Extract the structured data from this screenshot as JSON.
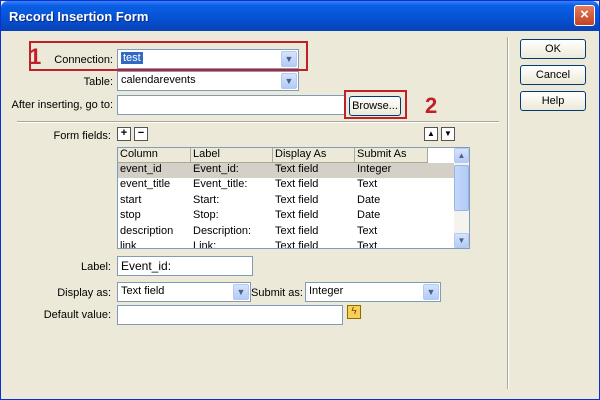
{
  "window": {
    "title": "Record Insertion Form"
  },
  "buttons": {
    "ok": "OK",
    "cancel": "Cancel",
    "help": "Help",
    "browse": "Browse..."
  },
  "form": {
    "connection_label": "Connection:",
    "connection_value": "test",
    "table_label": "Table:",
    "table_value": "calendarevents",
    "after_label": "After inserting, go to:",
    "after_value": "",
    "fields_label": "Form fields:",
    "add_glyph": "+",
    "remove_glyph": "−",
    "up_glyph": "▲",
    "down_glyph": "▼"
  },
  "annotations": {
    "one": "1",
    "two": "2"
  },
  "fields_table": {
    "columns": [
      "Column",
      "Label",
      "Display As",
      "Submit As"
    ],
    "rows": [
      [
        "event_id",
        "Event_id:",
        "Text field",
        "Integer"
      ],
      [
        "event_title",
        "Event_title:",
        "Text field",
        "Text"
      ],
      [
        "start",
        "Start:",
        "Text field",
        "Date"
      ],
      [
        "stop",
        "Stop:",
        "Text field",
        "Date"
      ],
      [
        "description",
        "Description:",
        "Text field",
        "Text"
      ],
      [
        "link",
        "Link:",
        "Text field",
        "Text"
      ]
    ]
  },
  "details": {
    "label_label": "Label:",
    "label_value": "Event_id:",
    "display_label": "Display as:",
    "display_value": "Text field",
    "submit_label": "Submit as:",
    "submit_value": "Integer",
    "default_label": "Default value:",
    "default_value": ""
  },
  "icons": {
    "close": "close-icon",
    "dropdown": "chevron-down-icon",
    "dynamic": "lightning-icon"
  },
  "colors": {
    "annotation_red": "#c0202a",
    "title_blue": "#0651d2",
    "selection": "#316ac5"
  }
}
